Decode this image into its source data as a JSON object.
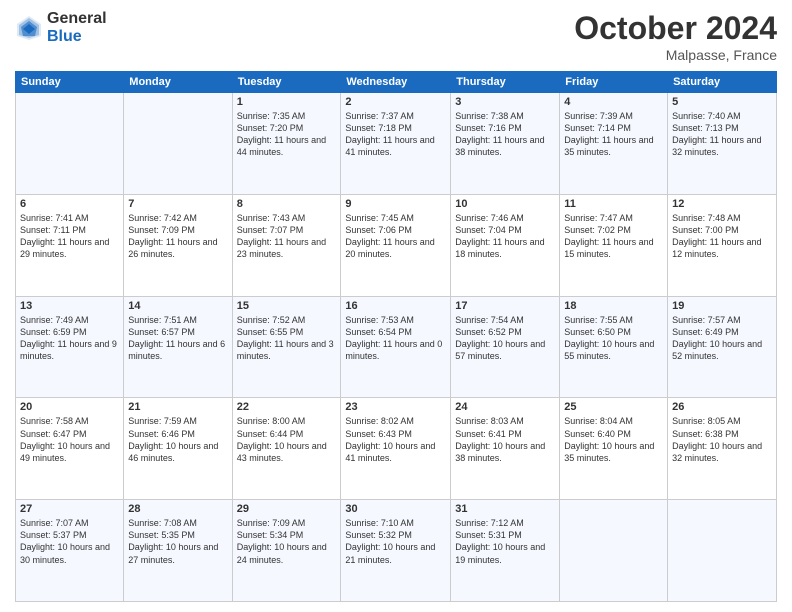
{
  "logo": {
    "general": "General",
    "blue": "Blue"
  },
  "header": {
    "month": "October 2024",
    "location": "Malpasse, France"
  },
  "weekdays": [
    "Sunday",
    "Monday",
    "Tuesday",
    "Wednesday",
    "Thursday",
    "Friday",
    "Saturday"
  ],
  "weeks": [
    [
      {
        "day": "",
        "sunrise": "",
        "sunset": "",
        "daylight": ""
      },
      {
        "day": "",
        "sunrise": "",
        "sunset": "",
        "daylight": ""
      },
      {
        "day": "1",
        "sunrise": "Sunrise: 7:35 AM",
        "sunset": "Sunset: 7:20 PM",
        "daylight": "Daylight: 11 hours and 44 minutes."
      },
      {
        "day": "2",
        "sunrise": "Sunrise: 7:37 AM",
        "sunset": "Sunset: 7:18 PM",
        "daylight": "Daylight: 11 hours and 41 minutes."
      },
      {
        "day": "3",
        "sunrise": "Sunrise: 7:38 AM",
        "sunset": "Sunset: 7:16 PM",
        "daylight": "Daylight: 11 hours and 38 minutes."
      },
      {
        "day": "4",
        "sunrise": "Sunrise: 7:39 AM",
        "sunset": "Sunset: 7:14 PM",
        "daylight": "Daylight: 11 hours and 35 minutes."
      },
      {
        "day": "5",
        "sunrise": "Sunrise: 7:40 AM",
        "sunset": "Sunset: 7:13 PM",
        "daylight": "Daylight: 11 hours and 32 minutes."
      }
    ],
    [
      {
        "day": "6",
        "sunrise": "Sunrise: 7:41 AM",
        "sunset": "Sunset: 7:11 PM",
        "daylight": "Daylight: 11 hours and 29 minutes."
      },
      {
        "day": "7",
        "sunrise": "Sunrise: 7:42 AM",
        "sunset": "Sunset: 7:09 PM",
        "daylight": "Daylight: 11 hours and 26 minutes."
      },
      {
        "day": "8",
        "sunrise": "Sunrise: 7:43 AM",
        "sunset": "Sunset: 7:07 PM",
        "daylight": "Daylight: 11 hours and 23 minutes."
      },
      {
        "day": "9",
        "sunrise": "Sunrise: 7:45 AM",
        "sunset": "Sunset: 7:06 PM",
        "daylight": "Daylight: 11 hours and 20 minutes."
      },
      {
        "day": "10",
        "sunrise": "Sunrise: 7:46 AM",
        "sunset": "Sunset: 7:04 PM",
        "daylight": "Daylight: 11 hours and 18 minutes."
      },
      {
        "day": "11",
        "sunrise": "Sunrise: 7:47 AM",
        "sunset": "Sunset: 7:02 PM",
        "daylight": "Daylight: 11 hours and 15 minutes."
      },
      {
        "day": "12",
        "sunrise": "Sunrise: 7:48 AM",
        "sunset": "Sunset: 7:00 PM",
        "daylight": "Daylight: 11 hours and 12 minutes."
      }
    ],
    [
      {
        "day": "13",
        "sunrise": "Sunrise: 7:49 AM",
        "sunset": "Sunset: 6:59 PM",
        "daylight": "Daylight: 11 hours and 9 minutes."
      },
      {
        "day": "14",
        "sunrise": "Sunrise: 7:51 AM",
        "sunset": "Sunset: 6:57 PM",
        "daylight": "Daylight: 11 hours and 6 minutes."
      },
      {
        "day": "15",
        "sunrise": "Sunrise: 7:52 AM",
        "sunset": "Sunset: 6:55 PM",
        "daylight": "Daylight: 11 hours and 3 minutes."
      },
      {
        "day": "16",
        "sunrise": "Sunrise: 7:53 AM",
        "sunset": "Sunset: 6:54 PM",
        "daylight": "Daylight: 11 hours and 0 minutes."
      },
      {
        "day": "17",
        "sunrise": "Sunrise: 7:54 AM",
        "sunset": "Sunset: 6:52 PM",
        "daylight": "Daylight: 10 hours and 57 minutes."
      },
      {
        "day": "18",
        "sunrise": "Sunrise: 7:55 AM",
        "sunset": "Sunset: 6:50 PM",
        "daylight": "Daylight: 10 hours and 55 minutes."
      },
      {
        "day": "19",
        "sunrise": "Sunrise: 7:57 AM",
        "sunset": "Sunset: 6:49 PM",
        "daylight": "Daylight: 10 hours and 52 minutes."
      }
    ],
    [
      {
        "day": "20",
        "sunrise": "Sunrise: 7:58 AM",
        "sunset": "Sunset: 6:47 PM",
        "daylight": "Daylight: 10 hours and 49 minutes."
      },
      {
        "day": "21",
        "sunrise": "Sunrise: 7:59 AM",
        "sunset": "Sunset: 6:46 PM",
        "daylight": "Daylight: 10 hours and 46 minutes."
      },
      {
        "day": "22",
        "sunrise": "Sunrise: 8:00 AM",
        "sunset": "Sunset: 6:44 PM",
        "daylight": "Daylight: 10 hours and 43 minutes."
      },
      {
        "day": "23",
        "sunrise": "Sunrise: 8:02 AM",
        "sunset": "Sunset: 6:43 PM",
        "daylight": "Daylight: 10 hours and 41 minutes."
      },
      {
        "day": "24",
        "sunrise": "Sunrise: 8:03 AM",
        "sunset": "Sunset: 6:41 PM",
        "daylight": "Daylight: 10 hours and 38 minutes."
      },
      {
        "day": "25",
        "sunrise": "Sunrise: 8:04 AM",
        "sunset": "Sunset: 6:40 PM",
        "daylight": "Daylight: 10 hours and 35 minutes."
      },
      {
        "day": "26",
        "sunrise": "Sunrise: 8:05 AM",
        "sunset": "Sunset: 6:38 PM",
        "daylight": "Daylight: 10 hours and 32 minutes."
      }
    ],
    [
      {
        "day": "27",
        "sunrise": "Sunrise: 7:07 AM",
        "sunset": "Sunset: 5:37 PM",
        "daylight": "Daylight: 10 hours and 30 minutes."
      },
      {
        "day": "28",
        "sunrise": "Sunrise: 7:08 AM",
        "sunset": "Sunset: 5:35 PM",
        "daylight": "Daylight: 10 hours and 27 minutes."
      },
      {
        "day": "29",
        "sunrise": "Sunrise: 7:09 AM",
        "sunset": "Sunset: 5:34 PM",
        "daylight": "Daylight: 10 hours and 24 minutes."
      },
      {
        "day": "30",
        "sunrise": "Sunrise: 7:10 AM",
        "sunset": "Sunset: 5:32 PM",
        "daylight": "Daylight: 10 hours and 21 minutes."
      },
      {
        "day": "31",
        "sunrise": "Sunrise: 7:12 AM",
        "sunset": "Sunset: 5:31 PM",
        "daylight": "Daylight: 10 hours and 19 minutes."
      },
      {
        "day": "",
        "sunrise": "",
        "sunset": "",
        "daylight": ""
      },
      {
        "day": "",
        "sunrise": "",
        "sunset": "",
        "daylight": ""
      }
    ]
  ]
}
